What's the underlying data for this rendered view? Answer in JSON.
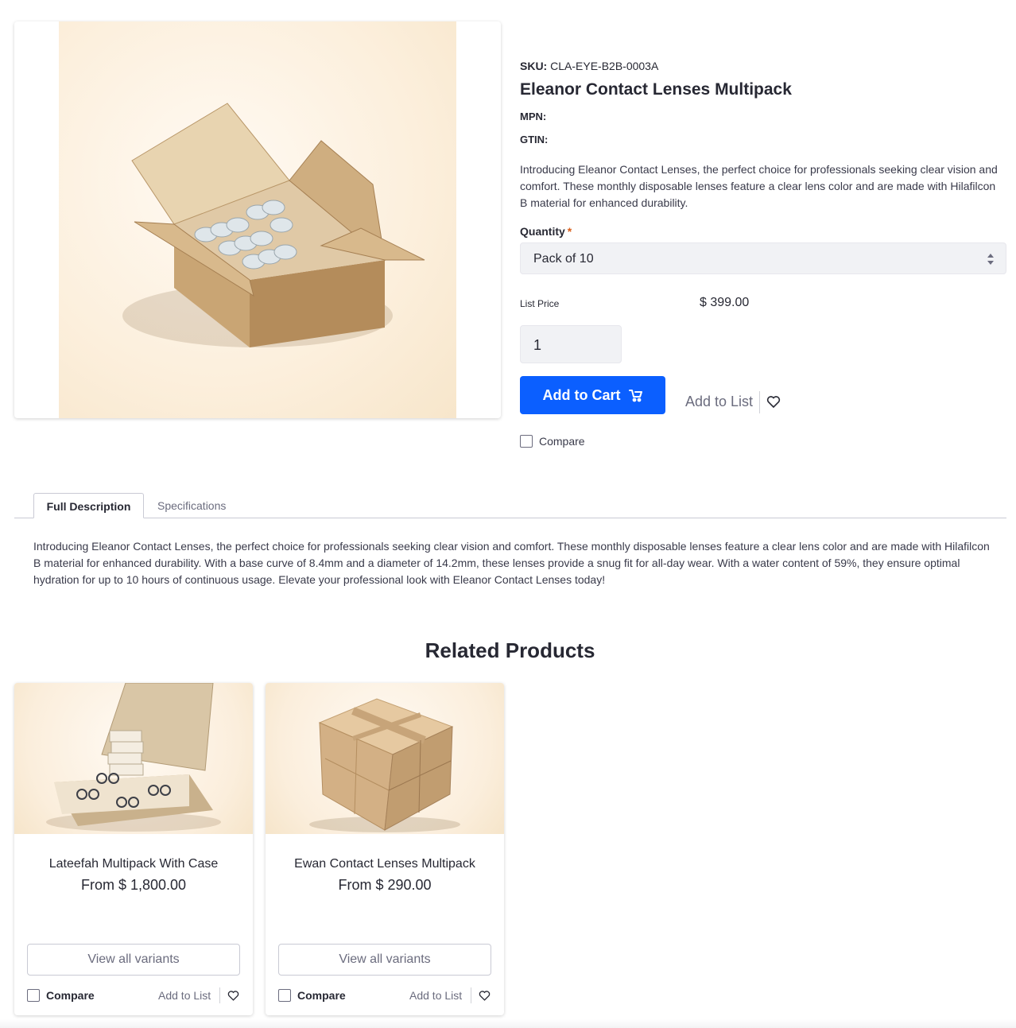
{
  "product": {
    "sku_label": "SKU:",
    "sku_value": "CLA-EYE-B2B-0003A",
    "title": "Eleanor Contact Lenses Multipack",
    "mpn_label": "MPN:",
    "gtin_label": "GTIN:",
    "short_description": "Introducing Eleanor Contact Lenses, the perfect choice for professionals seeking clear vision and comfort. These monthly disposable lenses feature a clear lens color and are made with Hilafilcon B material for enhanced durability.",
    "quantity_label": "Quantity",
    "required_mark": "*",
    "quantity_option": "Pack of 10",
    "list_price_label": "List Price",
    "list_price": "$ 399.00",
    "quantity_value": "1",
    "add_to_cart": "Add to Cart",
    "add_to_list": "Add to List",
    "compare": "Compare",
    "image_icon": "product-box-icon"
  },
  "tabs": [
    {
      "label": "Full Description",
      "active": true
    },
    {
      "label": "Specifications",
      "active": false
    }
  ],
  "full_description": "Introducing Eleanor Contact Lenses, the perfect choice for professionals seeking clear vision and comfort. These monthly disposable lenses feature a clear lens color and are made with Hilafilcon B material for enhanced durability. With a base curve of 8.4mm and a diameter of 14.2mm, these lenses provide a snug fit for all-day wear. With a water content of 59%, they ensure optimal hydration for up to 10 hours of continuous usage. Elevate your professional look with Eleanor Contact Lenses today!",
  "related": {
    "title": "Related Products",
    "items": [
      {
        "name": "Lateefah Multipack With Case",
        "price": "From $ 1,800.00",
        "view_variants": "View all variants",
        "compare": "Compare",
        "add_to_list": "Add to List"
      },
      {
        "name": "Ewan Contact Lenses Multipack",
        "price": "From $ 290.00",
        "view_variants": "View all variants",
        "compare": "Compare",
        "add_to_list": "Add to List"
      }
    ]
  },
  "colors": {
    "primary": "#0b5fff",
    "required": "#d9601d",
    "text": "#272833",
    "muted": "#6b6c7e"
  }
}
